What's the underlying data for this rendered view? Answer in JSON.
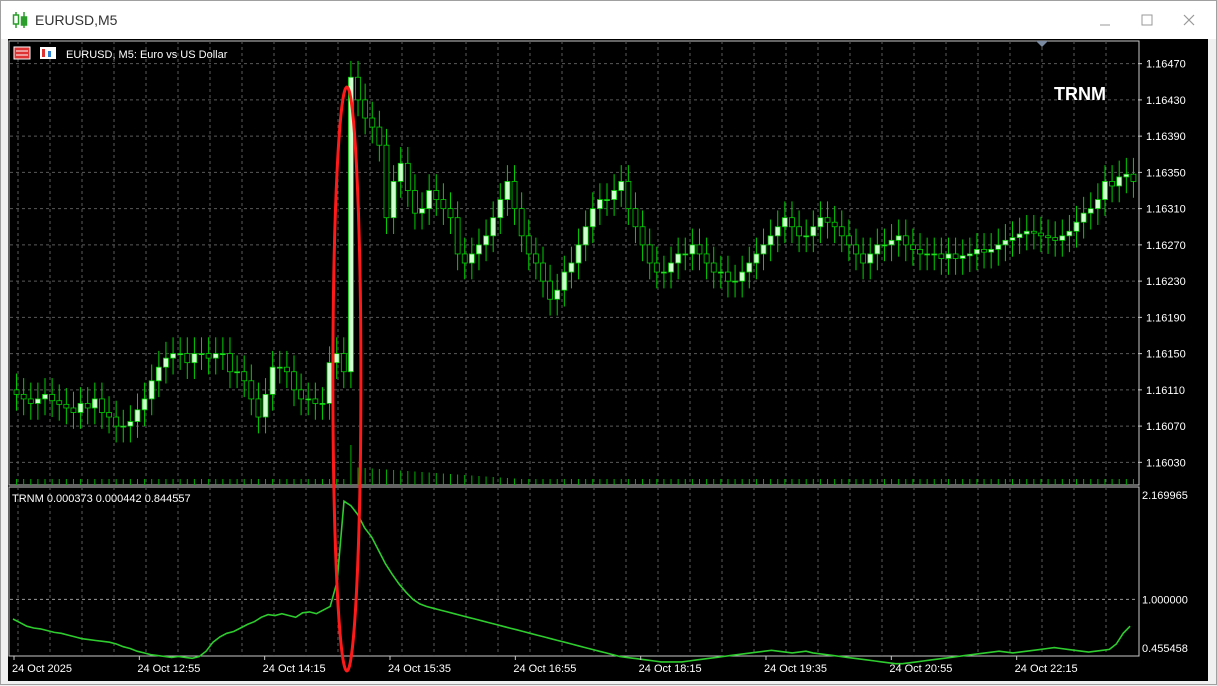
{
  "window": {
    "title": "EURUSD,M5"
  },
  "chart_data": [
    {
      "type": "candlestick",
      "title": "EURUSD, M5:  Euro vs US Dollar",
      "watermark": "TRNM",
      "price_ticks": [
        "1.16470",
        "1.16430",
        "1.16390",
        "1.16350",
        "1.16310",
        "1.16270",
        "1.16230",
        "1.16190",
        "1.16150",
        "1.16110",
        "1.16070",
        "1.16030"
      ],
      "time_ticks": [
        "24 Oct 2025",
        "24 Oct 12:55",
        "24 Oct 14:15",
        "24 Oct 15:35",
        "24 Oct 16:55",
        "24 Oct 18:15",
        "24 Oct 19:35",
        "24 Oct 20:55",
        "24 Oct 22:15"
      ],
      "ylim": [
        1.16005,
        1.16495
      ],
      "grid": true,
      "up_color": "#cfffcf",
      "down_color": "#000000",
      "wick_color": "#00d000",
      "highlight_color": "#ff1a1a",
      "highlight_index": 47,
      "close": [
        1.16105,
        1.161,
        1.16095,
        1.161,
        1.16105,
        1.16098,
        1.16094,
        1.1609,
        1.16085,
        1.16095,
        1.1609,
        1.161,
        1.16085,
        1.1608,
        1.1607,
        1.1607,
        1.16075,
        1.16088,
        1.161,
        1.1612,
        1.16135,
        1.16145,
        1.1615,
        1.1615,
        1.1614,
        1.1615,
        1.1615,
        1.16145,
        1.1615,
        1.1615,
        1.1613,
        1.1613,
        1.1612,
        1.161,
        1.1608,
        1.16105,
        1.16135,
        1.16135,
        1.1613,
        1.1611,
        1.161,
        1.161,
        1.16095,
        1.16095,
        1.1614,
        1.1615,
        1.1613,
        1.16455,
        1.1643,
        1.1641,
        1.164,
        1.1638,
        1.163,
        1.1634,
        1.1636,
        1.1633,
        1.16305,
        1.1631,
        1.1633,
        1.1632,
        1.1631,
        1.163,
        1.1626,
        1.1625,
        1.1626,
        1.1627,
        1.1628,
        1.163,
        1.1632,
        1.1634,
        1.1631,
        1.1628,
        1.1626,
        1.1625,
        1.1623,
        1.1621,
        1.1622,
        1.1624,
        1.1625,
        1.1627,
        1.1629,
        1.1631,
        1.1632,
        1.1632,
        1.1633,
        1.1634,
        1.1631,
        1.1629,
        1.1627,
        1.1625,
        1.1624,
        1.1624,
        1.1625,
        1.1626,
        1.1626,
        1.1627,
        1.1626,
        1.1625,
        1.1624,
        1.1624,
        1.1623,
        1.1623,
        1.1624,
        1.1625,
        1.1626,
        1.1627,
        1.1628,
        1.1629,
        1.163,
        1.1629,
        1.1628,
        1.1628,
        1.1629,
        1.163,
        1.16295,
        1.1629,
        1.1628,
        1.1627,
        1.1626,
        1.1625,
        1.1626,
        1.1627,
        1.1627,
        1.16275,
        1.1628,
        1.1627,
        1.16265,
        1.1626,
        1.1626,
        1.1626,
        1.16255,
        1.1626,
        1.16255,
        1.16258,
        1.1626,
        1.16265,
        1.16262,
        1.16265,
        1.1627,
        1.16275,
        1.16278,
        1.16282,
        1.16285,
        1.16283,
        1.1628,
        1.16278,
        1.16275,
        1.1628,
        1.16285,
        1.16295,
        1.16305,
        1.1631,
        1.1632,
        1.1634,
        1.16335,
        1.16345,
        1.16348,
        1.1634
      ]
    },
    {
      "type": "line",
      "title": "TRNM 0.000373 0.000442 0.844557",
      "value_ticks": [
        "2.169965",
        "1.000000",
        "0.455458"
      ],
      "ylim": [
        0.455458,
        2.169965
      ],
      "reference_level": 1.0,
      "line_color": "#2ecc2e",
      "values": [
        0.78,
        0.74,
        0.7,
        0.68,
        0.67,
        0.65,
        0.63,
        0.62,
        0.6,
        0.58,
        0.56,
        0.55,
        0.54,
        0.53,
        0.52,
        0.5,
        0.47,
        0.45,
        0.42,
        0.4,
        0.38,
        0.37,
        0.36,
        0.35,
        0.36,
        0.35,
        0.34,
        0.36,
        0.42,
        0.52,
        0.58,
        0.62,
        0.64,
        0.68,
        0.72,
        0.75,
        0.8,
        0.83,
        0.82,
        0.84,
        0.82,
        0.8,
        0.85,
        0.86,
        0.84,
        0.88,
        0.92,
        1.2,
        2.1,
        2.05,
        1.95,
        1.8,
        1.7,
        1.55,
        1.4,
        1.28,
        1.17,
        1.08,
        1.0,
        0.95,
        0.92,
        0.9,
        0.88,
        0.86,
        0.84,
        0.82,
        0.8,
        0.78,
        0.76,
        0.74,
        0.72,
        0.7,
        0.68,
        0.66,
        0.64,
        0.62,
        0.6,
        0.58,
        0.56,
        0.54,
        0.52,
        0.5,
        0.48,
        0.46,
        0.44,
        0.42,
        0.4,
        0.38,
        0.36,
        0.35,
        0.34,
        0.33,
        0.32,
        0.31,
        0.3,
        0.3,
        0.3,
        0.3,
        0.31,
        0.32,
        0.33,
        0.34,
        0.35,
        0.36,
        0.37,
        0.38,
        0.39,
        0.4,
        0.41,
        0.42,
        0.43,
        0.42,
        0.41,
        0.4,
        0.41,
        0.42,
        0.4,
        0.39,
        0.38,
        0.37,
        0.36,
        0.35,
        0.34,
        0.33,
        0.32,
        0.31,
        0.3,
        0.29,
        0.28,
        0.28,
        0.29,
        0.3,
        0.31,
        0.32,
        0.33,
        0.34,
        0.35,
        0.36,
        0.37,
        0.38,
        0.39,
        0.4,
        0.41,
        0.42,
        0.41,
        0.4,
        0.41,
        0.42,
        0.43,
        0.44,
        0.45,
        0.46,
        0.45,
        0.44,
        0.43,
        0.42,
        0.41,
        0.42,
        0.43,
        0.44,
        0.5,
        0.62,
        0.7
      ]
    }
  ]
}
